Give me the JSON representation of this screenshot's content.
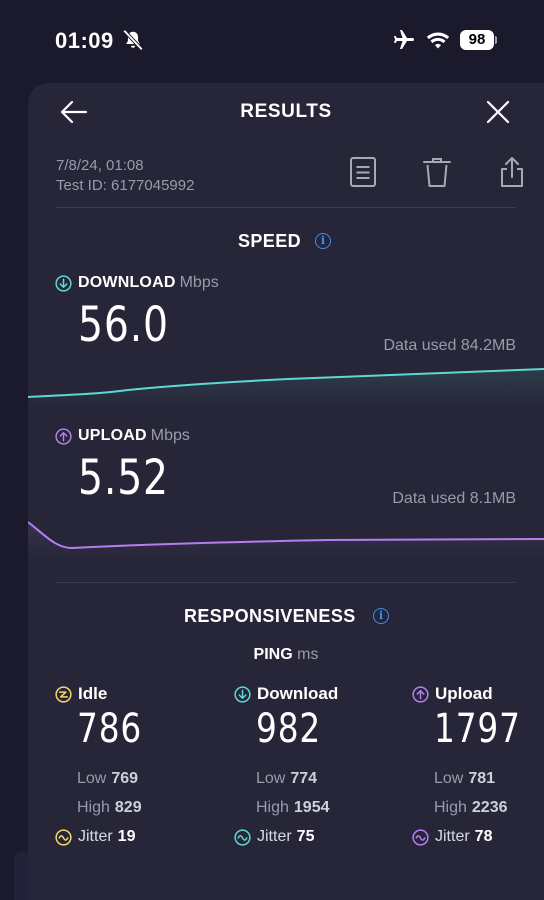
{
  "status_bar": {
    "time": "01:09",
    "battery": "98"
  },
  "header": {
    "title": "RESULTS"
  },
  "meta": {
    "date": "7/8/24, 01:08",
    "test_id": "Test ID: 6177045992"
  },
  "speed": {
    "title": "SPEED",
    "download": {
      "label": "DOWNLOAD",
      "unit": "Mbps",
      "value": "56.0",
      "data_used": "Data used 84.2MB"
    },
    "upload": {
      "label": "UPLOAD",
      "unit": "Mbps",
      "value": "5.52",
      "data_used": "Data used 8.1MB"
    }
  },
  "responsiveness": {
    "title": "RESPONSIVENESS",
    "ping_label": "PING",
    "ping_unit": "ms",
    "low_label": "Low",
    "high_label": "High",
    "jitter_label": "Jitter",
    "columns": [
      {
        "label": "Idle",
        "value": "786",
        "low": "769",
        "high": "829",
        "jitter": "19"
      },
      {
        "label": "Download",
        "value": "982",
        "low": "774",
        "high": "1954",
        "jitter": "75"
      },
      {
        "label": "Upload",
        "value": "1797",
        "low": "781",
        "high": "2236",
        "jitter": "78"
      }
    ]
  },
  "colors": {
    "background": "#1a1a2c",
    "card": "#262638",
    "download_accent": "#5ed8d2",
    "upload_accent": "#b57ef0",
    "idle_accent": "#f4d56a",
    "info_blue": "#3b8ff3",
    "muted_text": "#9a9aac"
  }
}
